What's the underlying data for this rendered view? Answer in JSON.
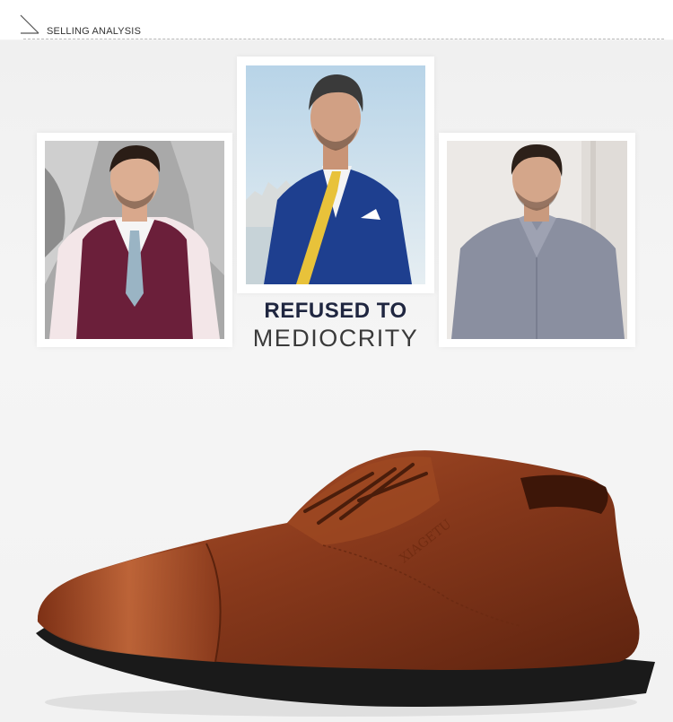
{
  "header": {
    "title": "SELLING ANALYSIS",
    "icon": "diagonal-arrow-icon"
  },
  "photos": [
    {
      "id": "left",
      "subject": "man in burgundy waistcoat",
      "icon": "model-photo"
    },
    {
      "id": "center",
      "subject": "man in blue suit with yellow tie",
      "icon": "model-photo"
    },
    {
      "id": "right",
      "subject": "man in grey shirt",
      "icon": "model-photo"
    }
  ],
  "slogan": {
    "line1": "REFUSED TO",
    "line2": "MEDIOCRITY"
  },
  "product": {
    "name": "brown leather oxford shoe",
    "color": "#8a3a1c"
  },
  "colors": {
    "background": "#f4f4f4",
    "slogan_dark": "#1f2640",
    "shoe_brown": "#8a3a1c",
    "sole": "#1a1a1a"
  }
}
